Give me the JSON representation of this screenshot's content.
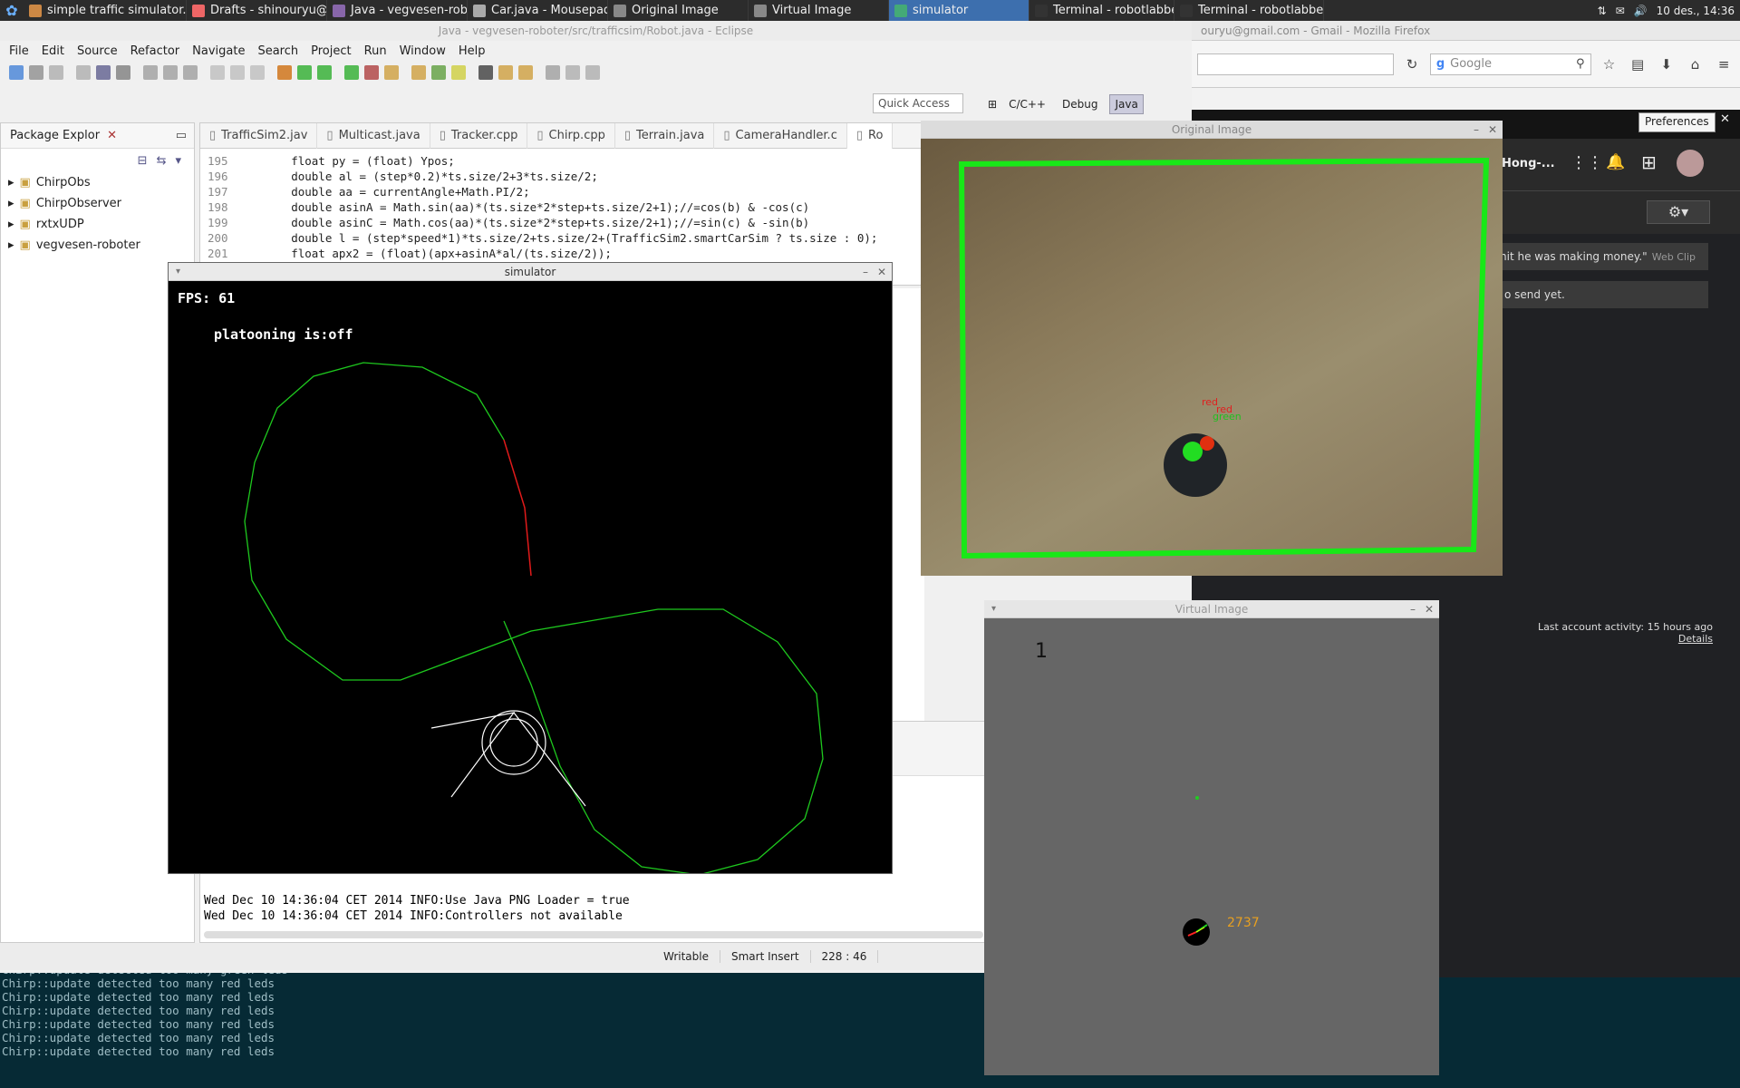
{
  "taskbar": {
    "tasks": [
      {
        "label": "simple traffic simulator.z...",
        "color": "#c84",
        "active": false
      },
      {
        "label": "Drafts - shinouryu@gmai...",
        "color": "#e66",
        "active": false
      },
      {
        "label": "Java - vegvesen-roboter/...",
        "color": "#86a",
        "active": false
      },
      {
        "label": "Car.java - Mousepad",
        "color": "#aaa",
        "active": false
      },
      {
        "label": "Original Image",
        "color": "#888",
        "active": false
      },
      {
        "label": "Virtual Image",
        "color": "#888",
        "active": false
      },
      {
        "label": "simulator",
        "color": "#4a7",
        "active": true
      },
      {
        "label": "Terminal - robotlabben@...",
        "color": "#333",
        "active": false
      },
      {
        "label": "Terminal - robotlabben@...",
        "color": "#333",
        "active": false
      }
    ],
    "clock": "10 des., 14:36"
  },
  "firefox": {
    "title": "ouryu@gmail.com - Gmail - Mozilla Firefox",
    "search_placeholder": "Google",
    "preferences_label": "Preferences",
    "user_name": "Hong-...",
    "snippet1": "nit he was making money.\"",
    "webclip": "Web Clip",
    "snippet2": "o send yet.",
    "last_activity": "Last account activity: 15 hours ago",
    "details": "Details"
  },
  "eclipse": {
    "title": "Java - vegvesen-roboter/src/trafficsim/Robot.java - Eclipse",
    "menu": [
      "File",
      "Edit",
      "Source",
      "Refactor",
      "Navigate",
      "Search",
      "Project",
      "Run",
      "Window",
      "Help"
    ],
    "quick_access": "Quick Access",
    "perspectives": [
      "C/C++",
      "Debug",
      "Java"
    ],
    "package_tab": "Package Explor",
    "projects": [
      "ChirpObs",
      "ChirpObserver",
      "rxtxUDP",
      "vegvesen-roboter"
    ],
    "editor_tabs": [
      "TrafficSim2.jav",
      "Multicast.java",
      "Tracker.cpp",
      "Chirp.cpp",
      "Terrain.java",
      "CameraHandler.c",
      "Ro"
    ],
    "code": [
      {
        "n": "195",
        "t": "        float py = (float) Ypos;"
      },
      {
        "n": "196",
        "t": "        double al = (step*0.2)*ts.size/2+3*ts.size/2;"
      },
      {
        "n": "197",
        "t": "        double aa = currentAngle+Math.PI/2;"
      },
      {
        "n": "198",
        "t": "        double asinA = Math.sin(aa)*(ts.size*2*step+ts.size/2+1);//=cos(b) & -cos(c)"
      },
      {
        "n": "199",
        "t": "        double asinC = Math.cos(aa)*(ts.size*2*step+ts.size/2+1);//=sin(c) & -sin(b)"
      },
      {
        "n": "200",
        "t": "        double l = (step*speed*1)*ts.size/2+ts.size/2+(TrafficSim2.smartCarSim ? ts.size : 0);"
      },
      {
        "n": "201",
        "t": "        float apx2 = (float)(apx+asinA*al/(ts.size/2));"
      }
    ],
    "console": [
      "Wed Dec 10 14:36:04 CET 2014 INFO:Use Java PNG Loader = true",
      "Wed Dec 10 14:36:04 CET 2014 INFO:Controllers not available"
    ],
    "status": [
      "Writable",
      "Smart Insert",
      "228 : 46"
    ]
  },
  "terminal": {
    "lines": [
      "Chirp::update detected too many green leds",
      "Chirp::update detected too many red leds",
      "Chirp::update detected too many red leds",
      "Chirp::update detected too many red leds",
      "Chirp::update detected too many red leds",
      "Chirp::update detected too many red leds",
      "Chirp::update detected too many red leds"
    ]
  },
  "simulator": {
    "title": "simulator",
    "fps": "FPS: 61",
    "platooning": "platooning is:off"
  },
  "original_image": {
    "title": "Original Image",
    "label_red": "red",
    "label_red2": "red",
    "label_green": "green"
  },
  "virtual_image": {
    "title": "Virtual Image",
    "marker": "1",
    "robot_id": "2737"
  }
}
